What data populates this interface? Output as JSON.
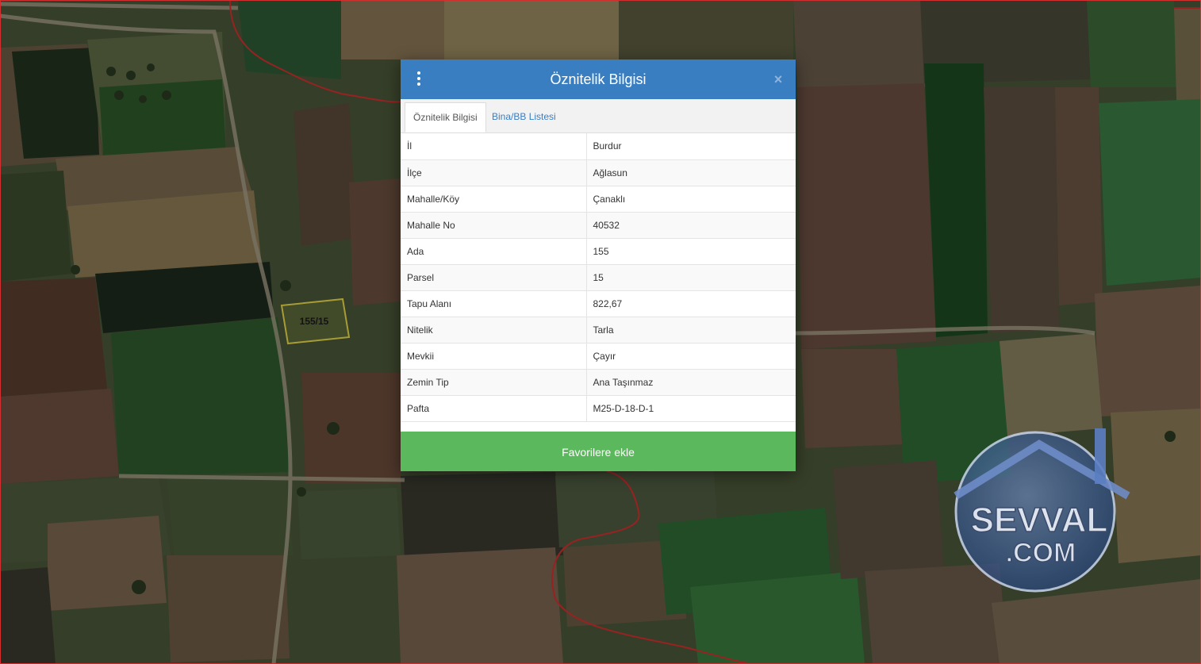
{
  "map": {
    "parcel_label": "155/15"
  },
  "modal": {
    "title": "Öznitelik Bilgisi",
    "close_glyph": "×",
    "menu_icon": "vertical-dots-icon",
    "tabs": [
      {
        "label": "Öznitelik Bilgisi",
        "active": true
      },
      {
        "label": "Bina/BB Listesi",
        "active": false
      }
    ],
    "rows": [
      {
        "key": "İl",
        "value": "Burdur"
      },
      {
        "key": "İlçe",
        "value": "Ağlasun"
      },
      {
        "key": "Mahalle/Köy",
        "value": "Çanaklı"
      },
      {
        "key": "Mahalle No",
        "value": "40532"
      },
      {
        "key": "Ada",
        "value": "155"
      },
      {
        "key": "Parsel",
        "value": "15"
      },
      {
        "key": "Tapu Alanı",
        "value": "822,67"
      },
      {
        "key": "Nitelik",
        "value": "Tarla"
      },
      {
        "key": "Mevkii",
        "value": "Çayır"
      },
      {
        "key": "Zemin Tip",
        "value": "Ana Taşınmaz"
      },
      {
        "key": "Pafta",
        "value": "M25-D-18-D-1"
      }
    ],
    "favorite_button": "Favorilere ekle"
  },
  "watermark": {
    "line1": "SEVVAL",
    "line2": ".COM"
  },
  "colors": {
    "header": "#3a7ec2",
    "button": "#5cb85c",
    "boundary": "#d23030",
    "parcel_outline": "#e8d84a"
  }
}
